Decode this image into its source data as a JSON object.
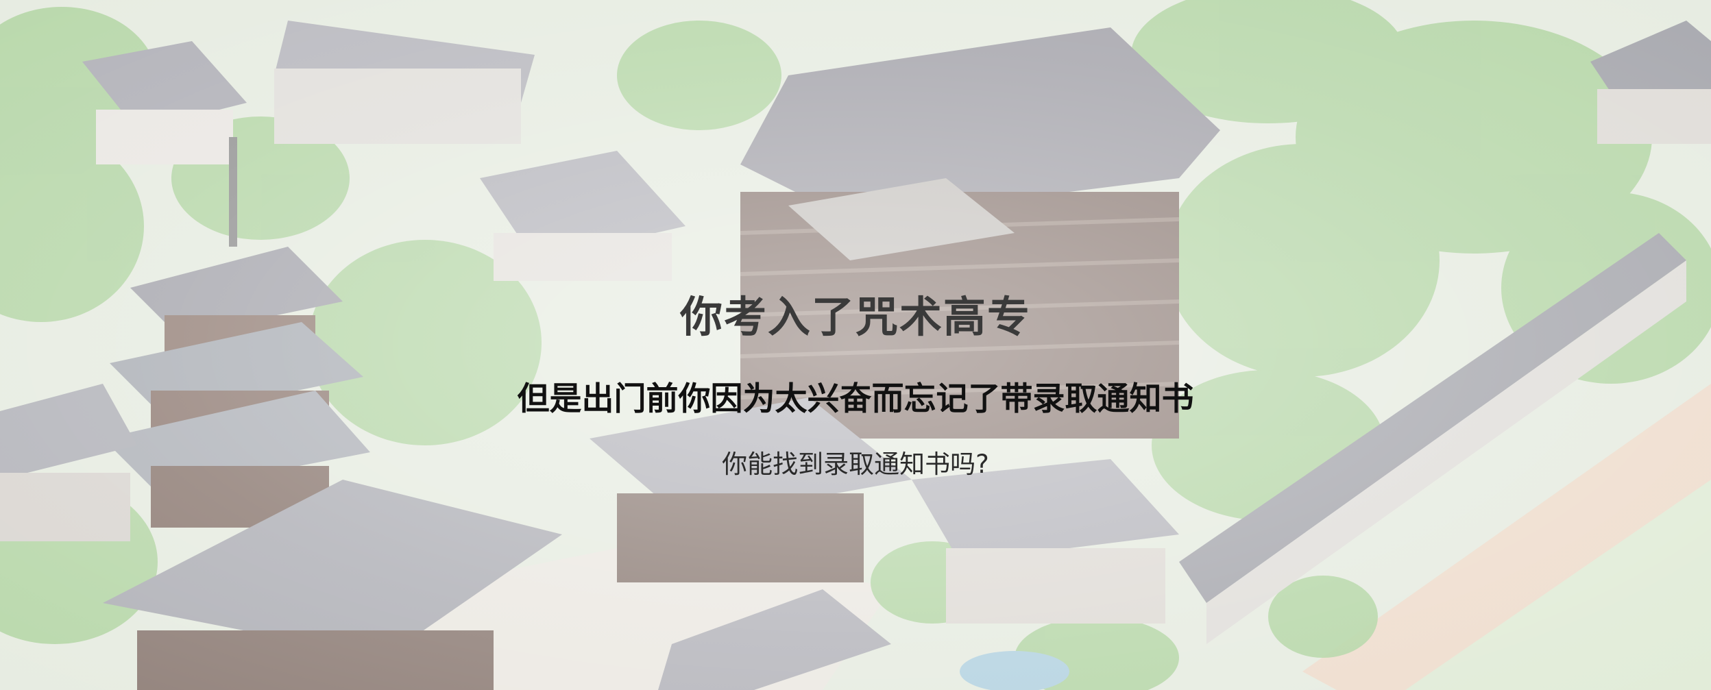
{
  "intro": {
    "title": "你考入了咒术高专",
    "subtitle": "但是出门前你因为太兴奋而忘记了带录取通知书",
    "question": "你能找到录取通知书吗?"
  },
  "background": {
    "scene": "aerial-view-of-temple-school-campus",
    "colors": {
      "foliage": "#8fbf7a",
      "roof": "#8a8a96",
      "wood": "#6b5a52",
      "wall": "#dcdad6",
      "ground": "#e7dccb",
      "track": "#e8c9b0"
    }
  }
}
